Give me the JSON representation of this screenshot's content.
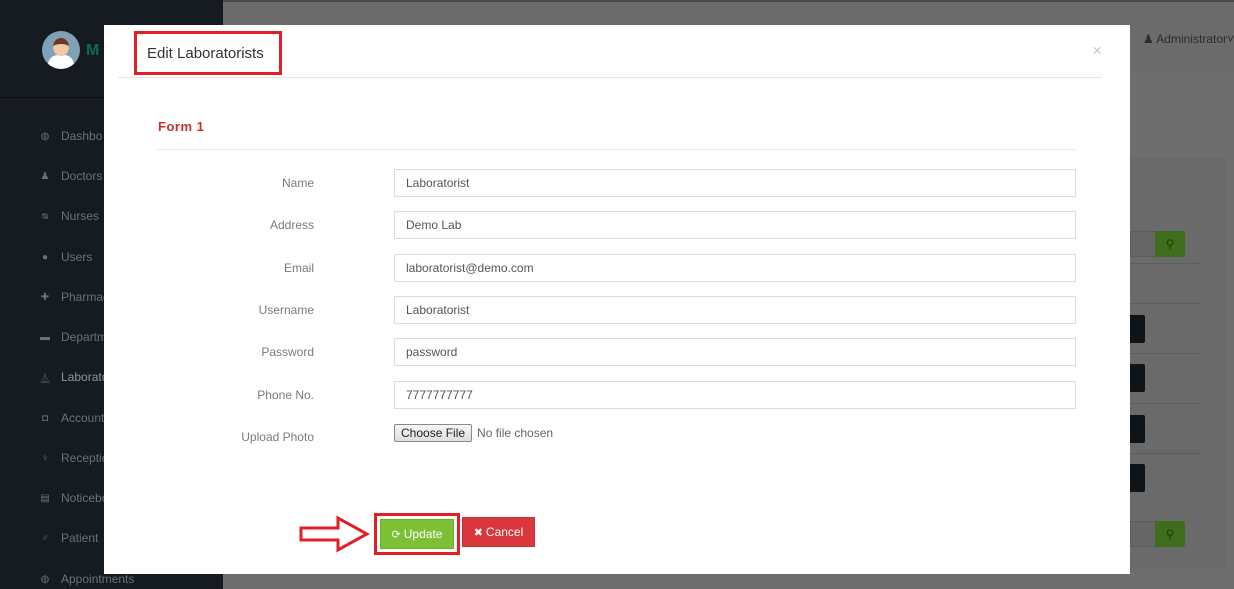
{
  "app": {
    "brand_text": "M",
    "user_menu": "Administrator"
  },
  "sidebar": {
    "items": [
      {
        "label": "Dashbo",
        "icon": "dashboard-icon",
        "glyph": "◍"
      },
      {
        "label": "Doctors",
        "icon": "user-md-icon",
        "glyph": "♟"
      },
      {
        "label": "Nurses",
        "icon": "stethoscope-icon",
        "glyph": "ᴓ"
      },
      {
        "label": "Users",
        "icon": "user-icon",
        "glyph": "●"
      },
      {
        "label": "Pharmac",
        "icon": "plus-square-icon",
        "glyph": "✚"
      },
      {
        "label": "Departm",
        "icon": "briefcase-icon",
        "glyph": "▬"
      },
      {
        "label": "Laborato",
        "icon": "flask-icon",
        "glyph": "⏅"
      },
      {
        "label": "Account",
        "icon": "money-icon",
        "glyph": "◘"
      },
      {
        "label": "Receptio",
        "icon": "female-icon",
        "glyph": "♀"
      },
      {
        "label": "Noticebo",
        "icon": "file-icon",
        "glyph": "▤"
      },
      {
        "label": "Patient",
        "icon": "male-icon",
        "glyph": "♂"
      },
      {
        "label": "Appointments",
        "icon": "cubes-icon",
        "glyph": "◍"
      }
    ]
  },
  "modal": {
    "title": "Edit Laboratorists",
    "close_glyph": "×",
    "section_title": "Form 1",
    "fields": [
      {
        "label": "Name",
        "value": "Laboratorist"
      },
      {
        "label": "Address",
        "value": "Demo Lab"
      },
      {
        "label": "Email",
        "value": "laboratorist@demo.com"
      },
      {
        "label": "Username",
        "value": "Laboratorist"
      },
      {
        "label": "Password",
        "value": "password"
      },
      {
        "label": "Phone No.",
        "value": "7777777777"
      }
    ],
    "upload": {
      "label": "Upload Photo",
      "button": "Choose File",
      "status": "No file chosen"
    },
    "update_label": "Update",
    "cancel_label": "Cancel"
  },
  "colors": {
    "accent_green": "#7cc036",
    "accent_red": "#d9363e",
    "highlight": "#e21f26",
    "section_title": "#c9302c"
  }
}
